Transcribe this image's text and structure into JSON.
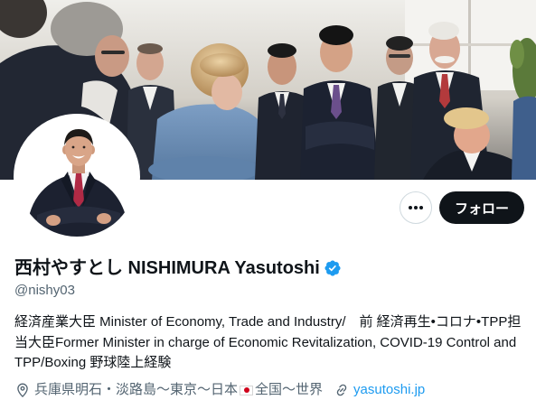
{
  "profile": {
    "display_name": "西村やすとし NISHIMURA Yasutoshi",
    "verified": true,
    "verified_icon": "verified-badge-icon",
    "handle": "@nishy03",
    "bio_lines": [
      "経済産業大臣 Minister of Economy, Trade and Industry/　前 経済再生•コロナ•TPP担",
      "当大臣Former Minister in charge of Economic Revitalization, COVID-19 Control and",
      "TPP/Boxing 野球陸上経験"
    ],
    "location": {
      "icon": "location-pin-icon",
      "text_before_flag": "兵庫県明石・淡路島〜東京〜日本",
      "flag_icon": "japan-flag-icon",
      "text_after_flag": "全国〜世界"
    },
    "website": {
      "icon": "link-icon",
      "label": "yasutoshi.jp"
    }
  },
  "actions": {
    "more_icon": "more-icon",
    "follow_label": "フォロー"
  },
  "colors": {
    "accent": "#1d9bf0",
    "text_primary": "#0f1419",
    "text_secondary": "#536471",
    "follow_button_bg": "#0f1419",
    "border": "#cfd9de"
  }
}
